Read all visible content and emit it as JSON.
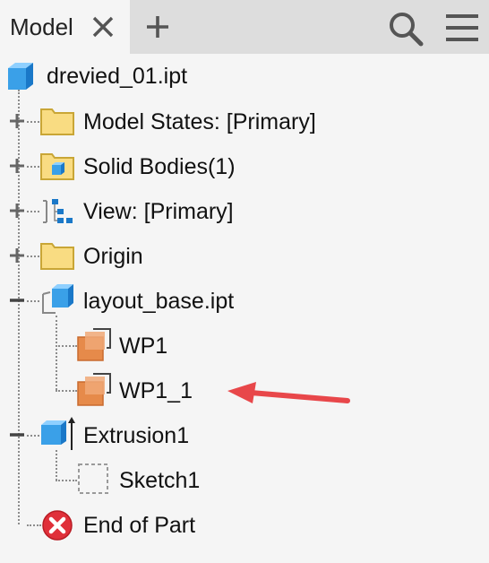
{
  "tabs": {
    "active_label": "Model"
  },
  "icons": {
    "close": "close-icon",
    "add": "plus-icon",
    "search": "search-icon",
    "menu": "hamburger-menu-icon"
  },
  "tree": {
    "root": {
      "label": "drevied_01.ipt",
      "icon": "part-cube-icon"
    },
    "items": [
      {
        "label": "Model States: [Primary]",
        "icon": "folder-icon",
        "expander": "plus"
      },
      {
        "label": "Solid Bodies(1)",
        "icon": "folder-solid-body-icon",
        "expander": "plus"
      },
      {
        "label": "View: [Primary]",
        "icon": "view-representation-icon",
        "expander": "plus"
      },
      {
        "label": "Origin",
        "icon": "folder-icon",
        "expander": "plus"
      },
      {
        "label": "layout_base.ipt",
        "icon": "derived-part-icon",
        "expander": "minus",
        "children": [
          {
            "label": "WP1",
            "icon": "work-plane-icon"
          },
          {
            "label": "WP1_1",
            "icon": "work-plane-icon"
          }
        ]
      },
      {
        "label": "Extrusion1",
        "icon": "extrusion-icon",
        "expander": "minus",
        "children": [
          {
            "label": "Sketch1",
            "icon": "sketch-icon"
          }
        ]
      },
      {
        "label": "End of Part",
        "icon": "end-of-part-icon"
      }
    ]
  },
  "annotation": {
    "arrow_color": "#e8474a",
    "target": "WP1_1"
  },
  "colors": {
    "folder_fill": "#f9dc82",
    "folder_stroke": "#c9a636",
    "cube_blue": "#3aa0e8",
    "workplane_orange": "#e68a4a",
    "error_red": "#e0303a"
  }
}
